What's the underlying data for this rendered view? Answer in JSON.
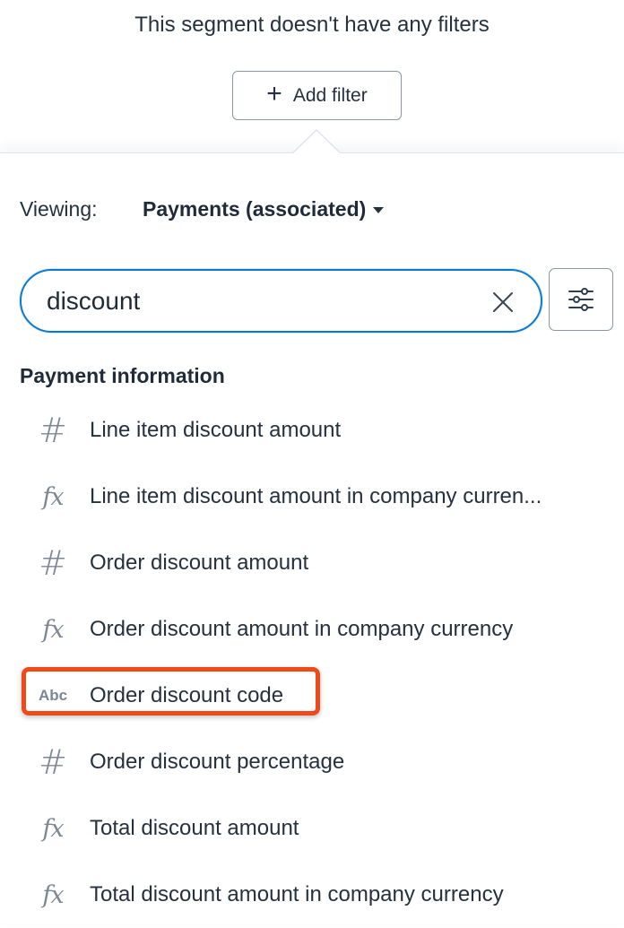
{
  "header": {
    "empty_message": "This segment doesn't have any filters",
    "add_filter_label": "Add filter"
  },
  "viewing": {
    "label": "Viewing:",
    "selected": "Payments (associated)"
  },
  "search": {
    "value": "discount"
  },
  "section": {
    "title": "Payment information"
  },
  "items": [
    {
      "icon": "hash-icon",
      "label": "Line item discount amount"
    },
    {
      "icon": "fx-icon",
      "label": "Line item discount amount in company curren..."
    },
    {
      "icon": "hash-icon",
      "label": "Order discount amount"
    },
    {
      "icon": "fx-icon",
      "label": "Order discount amount in company currency"
    },
    {
      "icon": "abc-icon",
      "icon_text": "Abc",
      "label": "Order discount code"
    },
    {
      "icon": "hash-icon",
      "label": "Order discount percentage"
    },
    {
      "icon": "fx-icon",
      "label": "Total discount amount"
    },
    {
      "icon": "fx-icon",
      "label": "Total discount amount in company currency"
    }
  ],
  "colors": {
    "accent": "#0a7ad1",
    "highlight": "#ef4a17",
    "text": "#25313e",
    "icon": "#7c8794"
  }
}
